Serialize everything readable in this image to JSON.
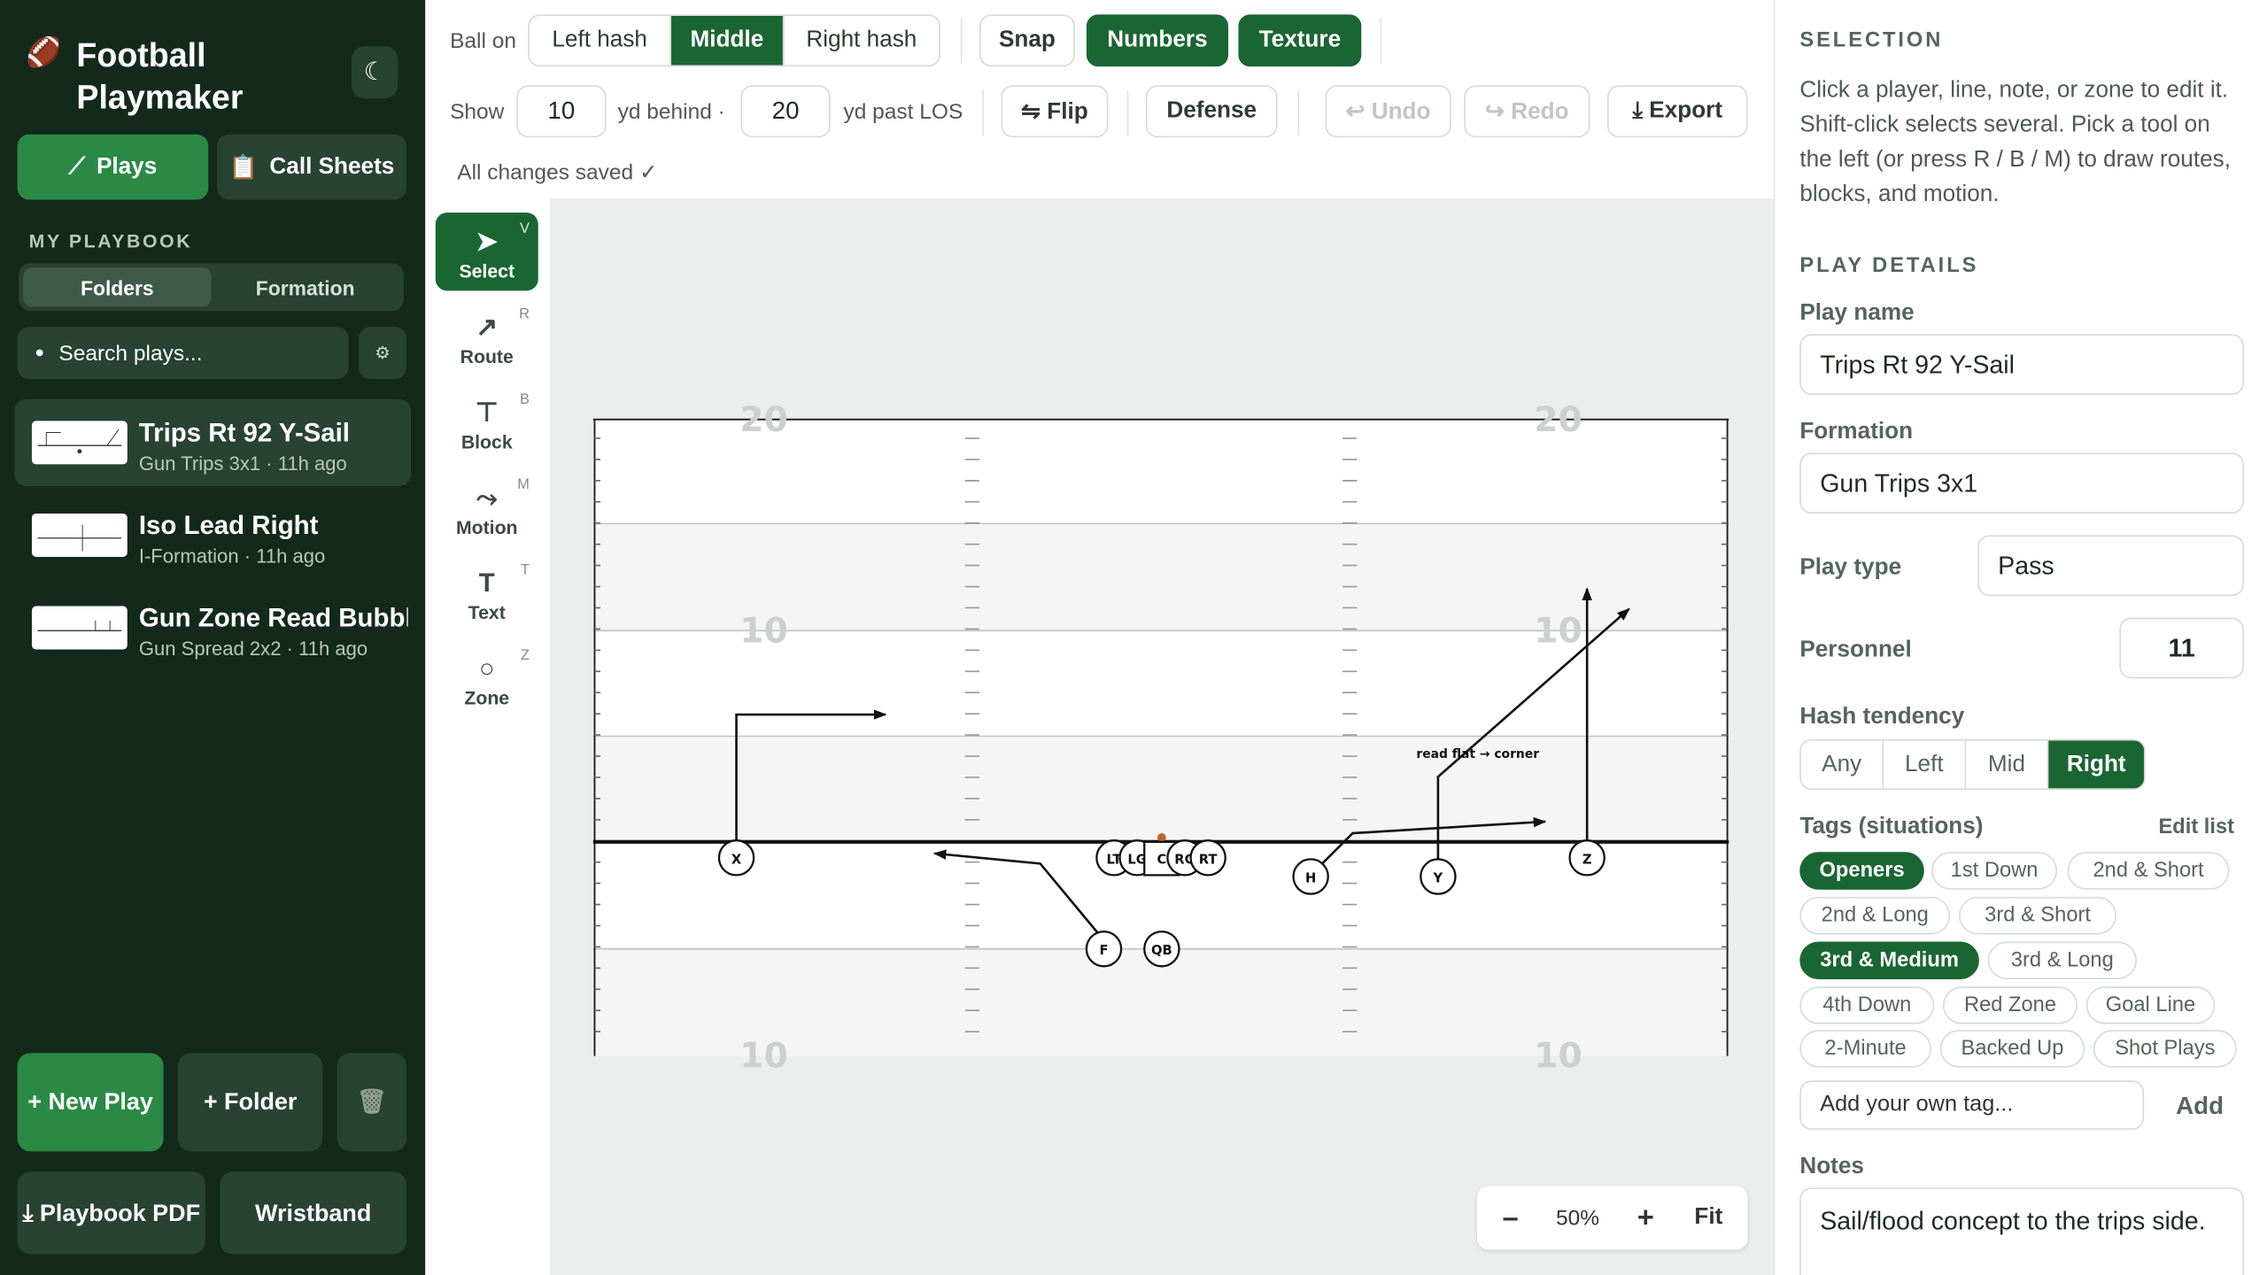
{
  "sidebar": {
    "brand_icon": "football-icon",
    "brand_title": "Football Playmaker",
    "nav": {
      "plays": "Plays",
      "call_sheets": "Call Sheets"
    },
    "section_label": "MY PLAYBOOK",
    "view_tabs": [
      "Folders",
      "Formation"
    ],
    "search_placeholder": "Search plays...",
    "plays": [
      {
        "name": "Trips Rt 92 Y-Sail",
        "meta": "Gun Trips 3x1 · 11h ago",
        "active": true
      },
      {
        "name": "Iso Lead Right",
        "meta": "I-Formation · 11h ago",
        "active": false
      },
      {
        "name": "Gun Zone Read Bubbl",
        "meta": "Gun Spread 2x2 · 11h ago",
        "active": false
      }
    ],
    "buttons": {
      "new_play": "+ New Play",
      "folder": "+ Folder",
      "playbook_pdf": "⤓ Playbook PDF",
      "wristband": "Wristband"
    }
  },
  "toolbar": {
    "ball_on": "Ball on",
    "hash_options": [
      "Left hash",
      "Middle",
      "Right hash"
    ],
    "hash_selected": "Middle",
    "snap": "Snap",
    "numbers": "Numbers",
    "texture": "Texture",
    "show": "Show",
    "behind_value": "10",
    "behind_label": "yd behind ·",
    "past_value": "20",
    "past_label": "yd past LOS",
    "flip": "⇋ Flip",
    "defense": "Defense",
    "undo": "↩ Undo",
    "redo": "↪ Redo",
    "export": "⤓ Export",
    "status": "All changes saved ✓"
  },
  "tools": [
    {
      "icon": "➤",
      "label": "Select",
      "key": "V",
      "active": true
    },
    {
      "icon": "↗",
      "label": "Route",
      "key": "R",
      "active": false
    },
    {
      "icon": "⊤",
      "label": "Block",
      "key": "B",
      "active": false
    },
    {
      "icon": "⤳",
      "label": "Motion",
      "key": "M",
      "active": false
    },
    {
      "icon": "T",
      "label": "Text",
      "key": "T",
      "active": false
    },
    {
      "icon": "○",
      "label": "Zone",
      "key": "Z",
      "active": false
    }
  ],
  "field": {
    "yard_numbers": {
      "top_left": "20",
      "top_right": "20",
      "mid_left": "10",
      "mid_right": "10",
      "bottom_left": "10",
      "bottom_right": "10"
    },
    "players": {
      "x": "X",
      "lt": "LT",
      "lg": "LG",
      "c": "C",
      "rg": "RG",
      "rt": "RT",
      "h": "H",
      "y": "Y",
      "z": "Z",
      "f": "F",
      "qb": "QB"
    },
    "note": "read flat → corner"
  },
  "zoom": {
    "minus": "–",
    "value": "50%",
    "plus": "+",
    "fit": "Fit"
  },
  "panel": {
    "selection_heading": "SELECTION",
    "selection_help": "Click a player, line, note, or zone to edit it. Shift-click selects several. Pick a tool on the left (or press R / B / M) to draw routes, blocks, and motion.",
    "details_heading": "PLAY DETAILS",
    "play_name_label": "Play name",
    "play_name": "Trips Rt 92 Y-Sail",
    "formation_label": "Formation",
    "formation": "Gun Trips 3x1",
    "play_type_label": "Play type",
    "play_type": "Pass",
    "personnel_label": "Personnel",
    "personnel": "11",
    "hash_label": "Hash tendency",
    "hash_options": [
      "Any",
      "Left",
      "Mid",
      "Right"
    ],
    "hash_selected": "Right",
    "tags_label": "Tags (situations)",
    "edit_list": "Edit list",
    "tags": [
      {
        "label": "Openers",
        "on": true
      },
      {
        "label": "1st Down",
        "on": false
      },
      {
        "label": "2nd & Short",
        "on": false
      },
      {
        "label": "2nd & Long",
        "on": false
      },
      {
        "label": "3rd & Short",
        "on": false
      },
      {
        "label": "3rd & Medium",
        "on": true
      },
      {
        "label": "3rd & Long",
        "on": false
      },
      {
        "label": "4th Down",
        "on": false
      },
      {
        "label": "Red Zone",
        "on": false
      },
      {
        "label": "Goal Line",
        "on": false
      },
      {
        "label": "2-Minute",
        "on": false
      },
      {
        "label": "Backed Up",
        "on": false
      },
      {
        "label": "Shot Plays",
        "on": false
      }
    ],
    "add_tag_placeholder": "Add your own tag...",
    "add_button": "Add",
    "notes_label": "Notes",
    "notes": "Sail/flood concept to the trips side."
  },
  "colors": {
    "sidebar_bg": "#13291c",
    "accent": "#1a6633",
    "accent_light": "#2a8a45"
  }
}
